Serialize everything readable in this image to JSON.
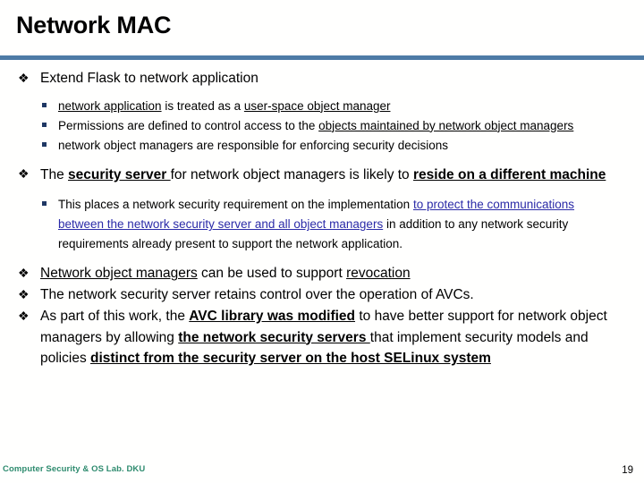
{
  "slide": {
    "title": "Network MAC",
    "accent_rule_color": "#4E7BA6",
    "bullet_glyph": "❖",
    "sub_bullet_color": "#1F3864",
    "link_color": "#2B2BA8"
  },
  "content": {
    "b1_extend": {
      "text": "Extend Flask to network application"
    },
    "sub1": {
      "a_pre": "",
      "a_u1": "network application",
      "a_mid": " is treated as a ",
      "a_u2": "user-space object manager",
      "b_pre": "Permissions are defined to control access to the ",
      "b_u1": "objects maintained by network object managers",
      "c_text": "network object managers are responsible for enforcing security decisions"
    },
    "b1_security_server": {
      "pre": "The ",
      "bold_u1": "security server ",
      "mid": "for network object managers is likely to ",
      "bold_u2": "reside on a different machine"
    },
    "sub2": {
      "pre": "This places a network security requirement on the implementation ",
      "link": "to protect the communications between the network security server and all object managers",
      "post": " in addition to any network security requirements already present to support the network application."
    },
    "b1_revocation": {
      "u1": "Network object managers",
      "mid": " can be used to support ",
      "u2": "revocation"
    },
    "b1_avc_control": {
      "text": "The network security server retains control over the operation of AVCs."
    },
    "b1_avc_library": {
      "pre": "As part of this work, the ",
      "bold_u1": "AVC library was modified",
      "mid": " to have better support for network object managers by allowing ",
      "bold_u2": "the network security servers ",
      "mid2": "that implement security models and policies ",
      "bold_u3": "distinct from the security server on the host SELinux system"
    }
  },
  "footer": {
    "organization": "Computer Security & OS Lab. DKU",
    "page_number": "19"
  }
}
